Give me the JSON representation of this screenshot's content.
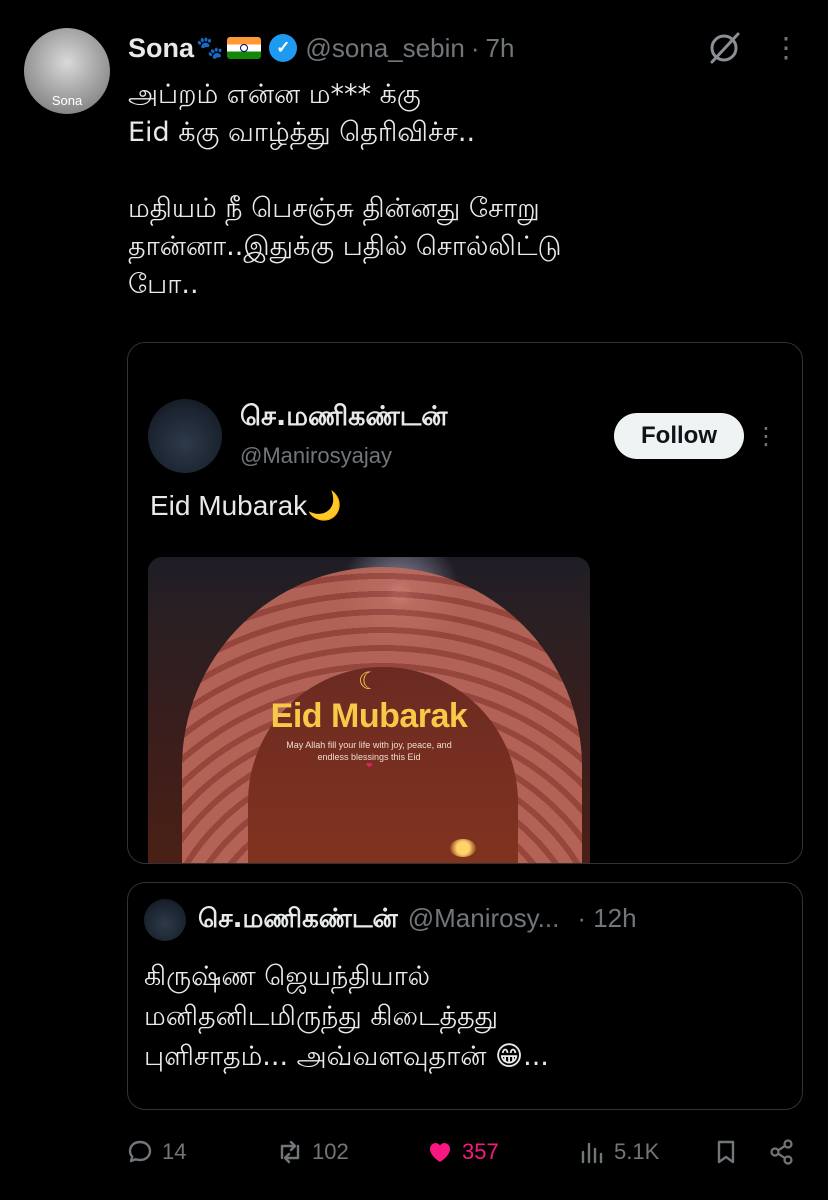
{
  "tweet": {
    "avatar_label": "Sona",
    "display_name": "Sona",
    "name_emoji": "🐾",
    "handle": "@sona_sebin",
    "separator": "·",
    "time": "7h",
    "text": "அப்றம் என்ன ம*** க்கு\nEid க்கு வாழ்த்து தெரிவிச்ச..\n\nமதியம் நீ பெசஞ்சு தின்னது சோறு\nதான்னா..இதுக்கு பதில் சொல்லிட்டு\nபோ..",
    "more_glyph": "⋮"
  },
  "quoted": {
    "display_name": "செ.மணிகண்டன்",
    "handle": "@Manirosyajay",
    "follow_label": "Follow",
    "more_glyph": "⋮",
    "text": "Eid Mubarak",
    "text_emoji": "🌙",
    "media": {
      "moon": "☾",
      "title": "Eid Mubarak",
      "subtitle": "May Allah fill your life with joy, peace, and endless blessings this Eid",
      "heart": "❤"
    }
  },
  "nested_quote": {
    "display_name": "செ.மணிகண்டன்",
    "handle": "@Manirosy...",
    "time": "· 12h",
    "text": "கிருஷ்ண ஜெயந்தியால்\nமனிதனிடமிருந்து கிடைத்தது\nபுளிசாதம்... அவ்வளவுதான் 😁..."
  },
  "actions": {
    "replies": "14",
    "reposts": "102",
    "likes": "357",
    "views": "5.1K"
  },
  "colors": {
    "background": "#000000",
    "text": "#e7e9ea",
    "muted": "#71767b",
    "like": "#f91880",
    "verified": "#1d9bf0"
  }
}
